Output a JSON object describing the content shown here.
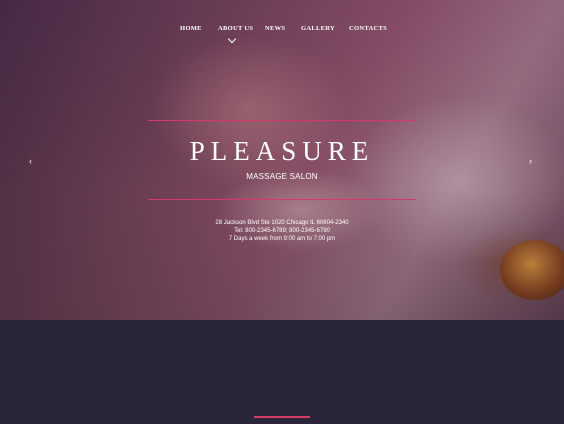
{
  "nav": {
    "items": [
      {
        "label": "HOME"
      },
      {
        "label": "ABOUT US"
      },
      {
        "label": "NEWS"
      },
      {
        "label": "GALLERY"
      },
      {
        "label": "CONTACTS"
      }
    ]
  },
  "hero": {
    "title": "PLEASURE",
    "subtitle": "MASSAGE SALON",
    "address": "28 Jackson Blvd Ste 1020 Chicago IL 60604-2340",
    "tel": "Tel: 800-2345-6789; 800-2345-6790",
    "hours": "7 Days a week from  9:00 am to 7:00 pm",
    "prev_arrow": "‹",
    "next_arrow": "›"
  },
  "colors": {
    "accent": "#d33a6a",
    "dark_bg": "#2a2538",
    "text": "#ffffff"
  },
  "icons": {
    "prev": "chevron-left-icon",
    "next": "chevron-right-icon",
    "dropdown": "chevron-down-icon"
  }
}
